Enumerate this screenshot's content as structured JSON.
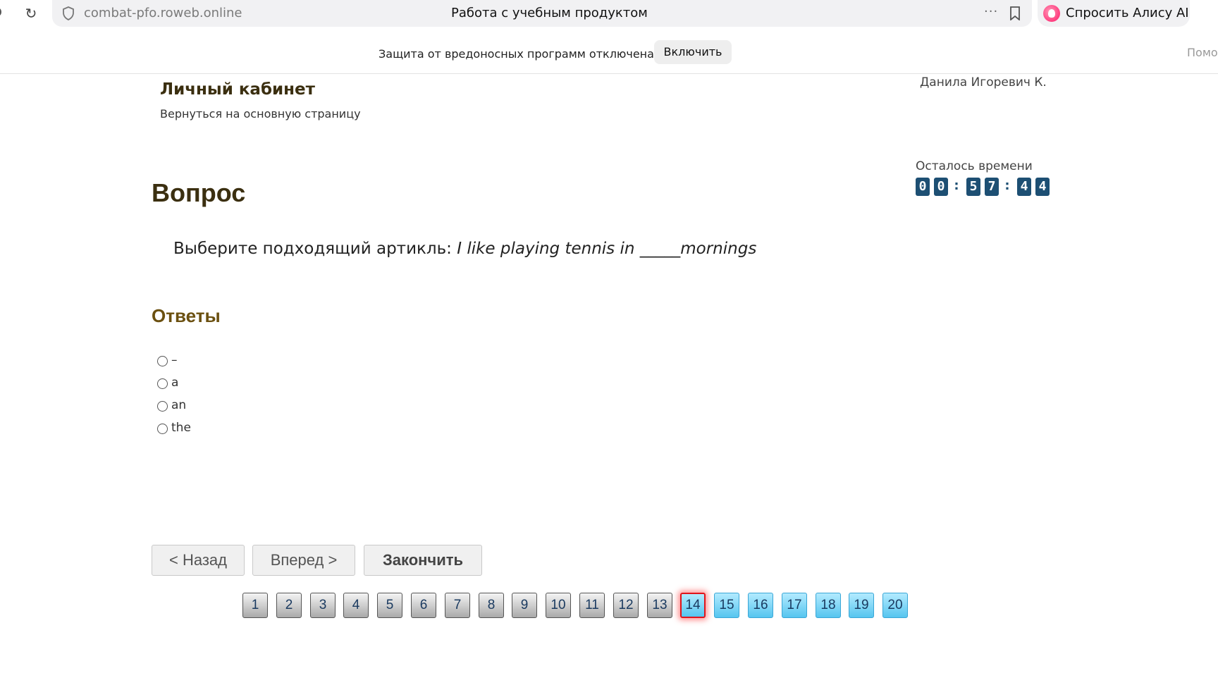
{
  "browser": {
    "url": "combat-pfo.roweb.online",
    "tab_title": "Работа с учебным продуктом",
    "more_label": "···",
    "alice_label": "Спросить Алису AI",
    "security_notice": "Защита от вредоносных программ отключена",
    "enable_label": "Включить",
    "help_label": "Помо"
  },
  "header": {
    "title": "Личный кабинет",
    "back_link": "Вернуться на основную страницу",
    "user_name": "Данила Игоревич К."
  },
  "timer": {
    "label": "Осталось времени",
    "digits": [
      "0",
      "0",
      "5",
      "7",
      "4",
      "4"
    ],
    "separator": ":"
  },
  "question": {
    "heading": "Вопрос",
    "prompt": "Выберите подходящий артикль: ",
    "sentence": "I like playing tennis in _____mornings"
  },
  "answers": {
    "heading": "Ответы",
    "options": [
      "–",
      "a",
      "an",
      "the"
    ]
  },
  "navigation": {
    "back_label": "< Назад",
    "forward_label": "Вперед >",
    "finish_label": "Закончить"
  },
  "pager": {
    "pages": [
      "1",
      "2",
      "3",
      "4",
      "5",
      "6",
      "7",
      "8",
      "9",
      "10",
      "11",
      "12",
      "13",
      "14",
      "15",
      "16",
      "17",
      "18",
      "19",
      "20"
    ],
    "current": 14,
    "answered_count": 13
  }
}
